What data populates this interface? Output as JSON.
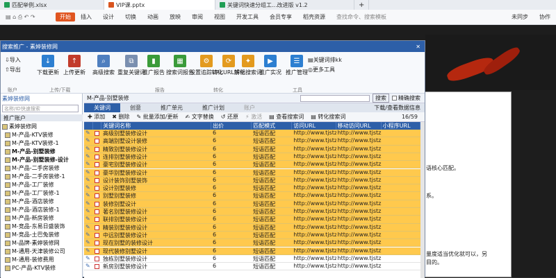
{
  "wps_tabs": [
    {
      "label": "匹配举例.xlsx",
      "color": "#1f9d55"
    },
    {
      "label": "VIP课.pptx",
      "color": "#d9541e"
    },
    {
      "label": "关键词快速分组工...改进版 v1.2",
      "color": "#1f9d55"
    }
  ],
  "wps_ribbon": {
    "items": [
      "开始",
      "插入",
      "设计",
      "切换",
      "动画",
      "放映",
      "审阅",
      "视图",
      "开发工具",
      "会员专享",
      "稻壳资源",
      "查找命令、搜索模板"
    ],
    "right": [
      "未同步",
      "协作"
    ]
  },
  "app": {
    "title": "搜索推广 - 素婷装修网",
    "tools": [
      {
        "label": "导入",
        "icon": "import-icon"
      },
      {
        "label": "导出",
        "icon": "export-icon"
      },
      {
        "label": "下载更新",
        "icon": "download-icon"
      },
      {
        "label": "上传更新",
        "icon": "upload-icon"
      },
      {
        "label": "高级搜索",
        "icon": "search-icon"
      },
      {
        "label": "重复关键词",
        "icon": "duplicate-icon"
      },
      {
        "label": "推广报告",
        "icon": "report-icon"
      },
      {
        "label": "搜索词报告",
        "icon": "search-report-icon"
      },
      {
        "label": "设置追踪URL",
        "icon": "track-icon"
      },
      {
        "label": "转化URL解析",
        "icon": "parse-icon"
      },
      {
        "label": "转化搜索词",
        "icon": "convert-icon"
      },
      {
        "label": "推广实况",
        "icon": "live-icon"
      },
      {
        "label": "推广管理",
        "icon": "manage-icon"
      },
      {
        "label": "关键词排kk",
        "icon": "rank-icon"
      },
      {
        "label": "更多工具",
        "icon": "more-icon"
      }
    ],
    "groups": [
      "账户",
      "上传/下载",
      "报告",
      "转化",
      "工具"
    ],
    "left": {
      "account": "素婷装修网",
      "search_ph": "名称/ID快速搜索",
      "heading": "推广账户",
      "tree": [
        "素婷装修网",
        "M-产品-KTV装修",
        "M-产品-KTV装修-1",
        "M-产品-别墅装修",
        "M-产品-别墅装修-设计",
        "M-产品-二手房装修",
        "M-产品-二手房装修-1",
        "M-产品-工厂装修",
        "M-产品-工厂装修-1",
        "M-产品-酒店装修",
        "M-产品-酒店装修-1",
        "M-产品-新房装修",
        "M-竞品-东易日盛装饰",
        "M-竞品-土巴兔装修",
        "M-品牌-素婷装修网",
        "M-通用-天津装修公司",
        "M-通用-装修费用",
        "PC-产品-KTV装修"
      ]
    },
    "breadcrumb": "M-产品-别墅装修",
    "search_btn": "搜索",
    "exact": "精确搜索",
    "download_view": "下载/查看数据信息",
    "tabs": [
      "关键词",
      "创意",
      "推广单元",
      "推广计划",
      "账户"
    ],
    "actions": [
      "添加",
      "删除",
      "批量添加/更新",
      "文字替换",
      "还原",
      "激活",
      "查看搜索词",
      "转化搜索词"
    ],
    "page": "16/59",
    "columns": [
      "关键词名称",
      "出价",
      "匹配模式",
      "访问URL",
      "移动访问URL",
      "小程序URL"
    ],
    "rows": [
      [
        "高级别墅装修设计",
        "6",
        "短语匹配",
        "http://www.tjstzx...",
        "http://www.tjstzx..."
      ],
      [
        "高端别墅设计装修",
        "6",
        "短语匹配",
        "http://www.tjstzx...",
        "http://www.tjstzx..."
      ],
      [
        "精致别墅装修设计",
        "6",
        "短语匹配",
        "http://www.tjstzx...",
        "http://www.tjstzx..."
      ],
      [
        "连排别墅装修设计",
        "6",
        "短语匹配",
        "http://www.tjstzx...",
        "http://www.tjstzx..."
      ],
      [
        "豪宅别墅装修设计",
        "6",
        "短语匹配",
        "http://www.tjstzx...",
        "http://www.tjstzx..."
      ],
      [
        "豪华别墅装修设计",
        "6",
        "短语匹配",
        "http://www.tjstzx...",
        "http://www.tjstzx..."
      ],
      [
        "设计装饰别墅装饰",
        "6",
        "短语匹配",
        "http://www.tjstzx...",
        "http://www.tjstzx..."
      ],
      [
        "设计别墅装修",
        "6",
        "短语匹配",
        "http://www.tjstzx...",
        "http://www.tjstzx..."
      ],
      [
        "别墅别墅装修",
        "6",
        "短语匹配",
        "http://www.tjstzx...",
        "http://www.tjstzx..."
      ],
      [
        "装修别墅设计",
        "6",
        "短语匹配",
        "http://www.tjstzx...",
        "http://www.tjstzx..."
      ],
      [
        "著名别墅装修设计",
        "6",
        "短语匹配",
        "http://www.tjstzx...",
        "http://www.tjstzx..."
      ],
      [
        "联排别墅装修设计",
        "6",
        "短语匹配",
        "http://www.tjstzx...",
        "http://www.tjstzx..."
      ],
      [
        "精装别墅装修设计",
        "6",
        "短语匹配",
        "http://www.tjstzx...",
        "http://www.tjstzx..."
      ],
      [
        "中远别墅装修设计",
        "6",
        "短语匹配",
        "http://www.tjstzx...",
        "http://www.tjstzx..."
      ],
      [
        "现在别墅的装修设计",
        "6",
        "短语匹配",
        "http://www.tjstzx...",
        "http://www.tjstzx..."
      ],
      [
        "现代装修别墅设计",
        "6",
        "短语匹配",
        "http://www.tjstzx...",
        "http://www.tjstzx..."
      ],
      [
        "独栋别墅装修设计",
        "6",
        "短语匹配",
        "http://www.tjstzx...",
        "http://www.tjstzx..."
      ],
      [
        "新房别墅装修设计",
        "6",
        "短语匹配",
        "http://www.tjstzx...",
        "http://www.tjstzx..."
      ]
    ]
  },
  "doc": {
    "lines": [
      "语核心匹配。",
      "系。",
      "量度适当优化就可以，另",
      "目的。"
    ]
  }
}
